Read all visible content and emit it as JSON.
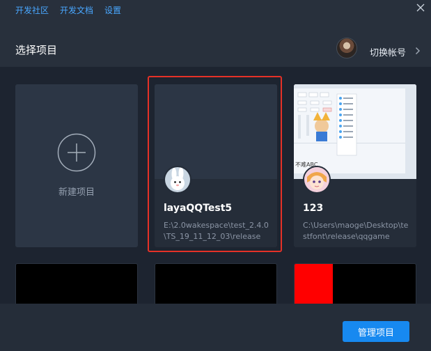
{
  "topbar": {
    "links": [
      "开发社区",
      "开发文档",
      "设置"
    ]
  },
  "header": {
    "title": "选择项目",
    "switch_account": "切换帐号"
  },
  "new_project": {
    "label": "新建项目"
  },
  "projects": [
    {
      "name": "layaQQTest5",
      "path": "E:\\2.0wakespace\\test_2.4.0\\TS_19_11_12_03\\release",
      "selected": true
    },
    {
      "name": "123",
      "path": "C:\\Users\\maoge\\Desktop\\testfont\\release\\qqgame",
      "selected": false
    }
  ],
  "preview_text": "不难ABC",
  "footer": {
    "manage_button": "管理项目"
  },
  "colors": {
    "accent": "#1789f0",
    "link": "#49a7ff",
    "selected_border": "#e53127"
  }
}
